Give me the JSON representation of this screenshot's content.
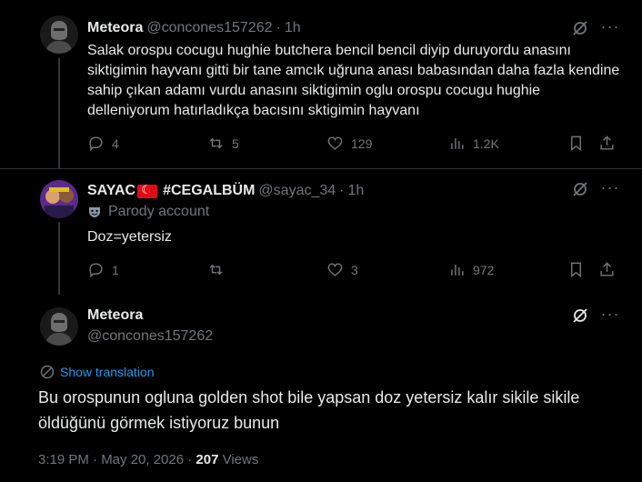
{
  "tweets": [
    {
      "name": "Meteora",
      "handle": "@concones157262",
      "time": "1h",
      "text": "Salak orospu cocugu hughie butchera bencil bencil diyip duruyordu anasını siktigimin hayvanı gitti bir tane amcık uğruna anası babasından daha fazla kendine sahip çıkan adamı vurdu anasını siktigimin oglu orospu cocugu hughie delleniyorum hatırladıkça bacısını sktigimin hayvanı",
      "replies": "4",
      "reposts": "5",
      "likes": "129",
      "views": "1.2K"
    },
    {
      "name_prefix": "SAYAC",
      "name_suffix": "#CEGALBÜM",
      "handle": "@sayac_34",
      "time": "1h",
      "parody_label": "Parody account",
      "text": "Doz=yetersiz",
      "replies": "1",
      "reposts": "",
      "likes": "3",
      "views": "972"
    }
  ],
  "main": {
    "name": "Meteora",
    "handle": "@concones157262",
    "translate_label": "Show translation",
    "text": "Bu orospunun ogluna golden shot bile yapsan doz yetersiz kalır sikile sikile öldüğünü görmek istiyoruz bunun",
    "timestamp": "3:19 PM · May 20, 2026 · ",
    "views_count": "207",
    "views_label": " Views"
  },
  "colors": {
    "background": "#000000",
    "text": "#e7e9ea",
    "muted": "#71767b",
    "link": "#1d9bf0",
    "divider": "#2f3336"
  },
  "icons": [
    "reply-icon",
    "repost-icon",
    "like-icon",
    "views-icon",
    "bookmark-icon",
    "share-icon",
    "grok-icon",
    "more-icon",
    "translate-icon",
    "parody-icon"
  ]
}
